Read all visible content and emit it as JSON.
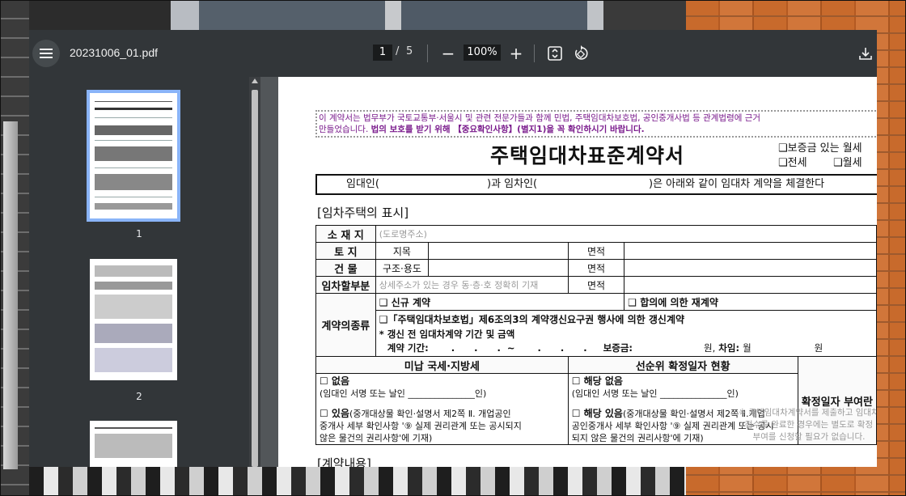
{
  "viewer": {
    "file_name": "20231006_01.pdf",
    "current_page": "1",
    "page_separator": "/",
    "total_pages": "5",
    "zoom": "100%",
    "zoom_out_label": "−",
    "zoom_in_label": "+",
    "icons": [
      "menu-icon",
      "zoom-out-icon",
      "zoom-in-icon",
      "fit-page-icon",
      "rotate-icon",
      "download-icon"
    ]
  },
  "sidebar": {
    "thumbnails": [
      {
        "label": "1",
        "selected": true
      },
      {
        "label": "2",
        "selected": false
      },
      {
        "label": "",
        "selected": false
      }
    ]
  },
  "document": {
    "notice_line1": "이 계약서는 법무부가 국토교통부·서울시 및 관련 전문가들과 함께 민법, 주택임대차보호법, 공인중개사법 등 관계법령에 근거",
    "notice_line2_pre": "만들었습니다. ",
    "notice_line2_bold": "법의 보호를 받기 위해 【중요확인사항】(별지1)을 꼭 확인하시기 바랍니다.",
    "title": "주택임대차표준계약서",
    "option_deposit_monthly": "❑보증금 있는 월세",
    "option_jeonse": "❑전세",
    "option_monthly": "❑월세",
    "parties_landlord": "임대인(",
    "parties_mid": ")과 임차인(",
    "parties_end": ")은 아래와 같이 임대차 계약을 체결한다",
    "section_property": "[임차주택의 표시]",
    "row_address_label": "소 재 지",
    "row_address_placeholder": "(도로명주소)",
    "row_land_label": "토   지",
    "row_land_field": "지목",
    "row_area_label": "면적",
    "row_building_label": "건   물",
    "row_building_field": "구조·용도",
    "row_leased_label": "임차할부분",
    "row_leased_placeholder": "상세주소가 있는 경우 동·층·호 정확히 기재",
    "contract_type_label": "계약의종류",
    "contract_new": "❑ 신규 계약",
    "contract_renew_agree": "❑ 합의에 의한 재계약",
    "contract_renew_right": "❑「주택임대차보호법」제6조의3의 계약갱신요구권 행사에 의한 갱신계약",
    "renew_note": "* 갱신 전 임대차계약 기간 및 금액",
    "renew_period": "계약 기간:       .      .      .  ~       .      .      .     보증금:",
    "renew_deposit_unit": "원,",
    "renew_rent_label": "차임:",
    "renew_rent_period": "월",
    "renew_rent_unit": "원",
    "tax_header": "미납 국세·지방세",
    "priority_header": "선순위 확정일자 현황",
    "fixed_date_header": "확정일자 부여란",
    "tax_none": "☐ 없음",
    "tax_none_sign": "(임대인 서명 또는 날인 _______________인)",
    "tax_exists": "☐ 있음",
    "tax_exists_detail1": "(중개대상물 확인·설명서 제2쪽 Ⅱ. 개업공인",
    "tax_exists_detail2": "중개사 세부 확인사항 '⑨ 실제 권리관계 또는 공시되지",
    "tax_exists_detail3": "않은 물건의 권리사항'에 기재)",
    "prio_none": "☐ 해당 없음",
    "prio_none_sign": "(임대인 서명 또는 날인 _______________인)",
    "prio_exists": "☐ 해당 있음",
    "prio_exists_detail1": "(중개대상물 확인·설명서 제2쪽 Ⅱ.개업",
    "prio_exists_detail2": "공인중개사 세부 확인사항 '⑨ 실제 권리관계 또는 공시",
    "prio_exists_detail3": "되지 않은 물건의 권리사항'에 기재)",
    "fixed_note1": "※ 주택임대차계약서를 제출하고 임대차",
    "fixed_note2": "접수를 완료한 경우에는 별도로 확정",
    "fixed_note3": "부여를 신청할 필요가 없습니다.",
    "section_contract": "[계약내용]"
  }
}
